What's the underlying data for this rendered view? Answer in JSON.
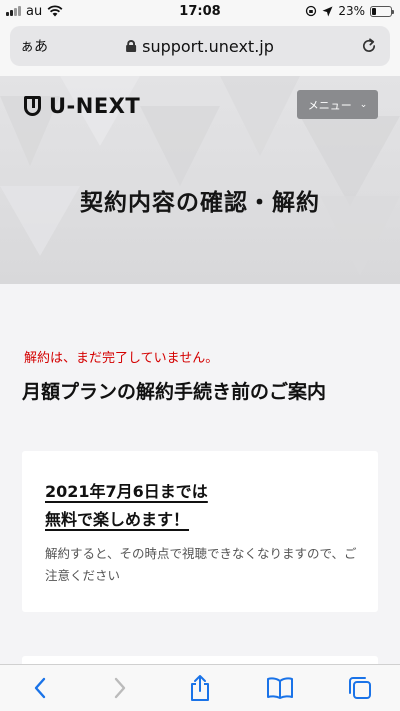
{
  "status_bar": {
    "carrier": "au",
    "time": "17:08",
    "battery": "23%",
    "battery_level": 0.23
  },
  "browser": {
    "aa_label": "ぁあ",
    "url": "support.unext.jp"
  },
  "header": {
    "logo_text": "U-NEXT",
    "menu_label": "メニュー",
    "page_title": "契約内容の確認・解約"
  },
  "main": {
    "notice": "解約は、まだ完了していません。",
    "section_title": "月額プランの解約手続き前のご案内",
    "card": {
      "headline_line1": "2021年7月6日までは",
      "headline_line2": "無料で楽しめます！",
      "body": "解約すると、その時点で視聴できなくなりますので、ご注意ください"
    }
  },
  "icons": {
    "back": "chevron-left-icon",
    "forward": "chevron-right-icon",
    "share": "share-icon",
    "bookmarks": "book-icon",
    "tabs": "tabs-icon"
  },
  "colors": {
    "accent_blue": "#1a73e8",
    "notice_red": "#d40000",
    "menu_button": "#8a8b8e"
  }
}
